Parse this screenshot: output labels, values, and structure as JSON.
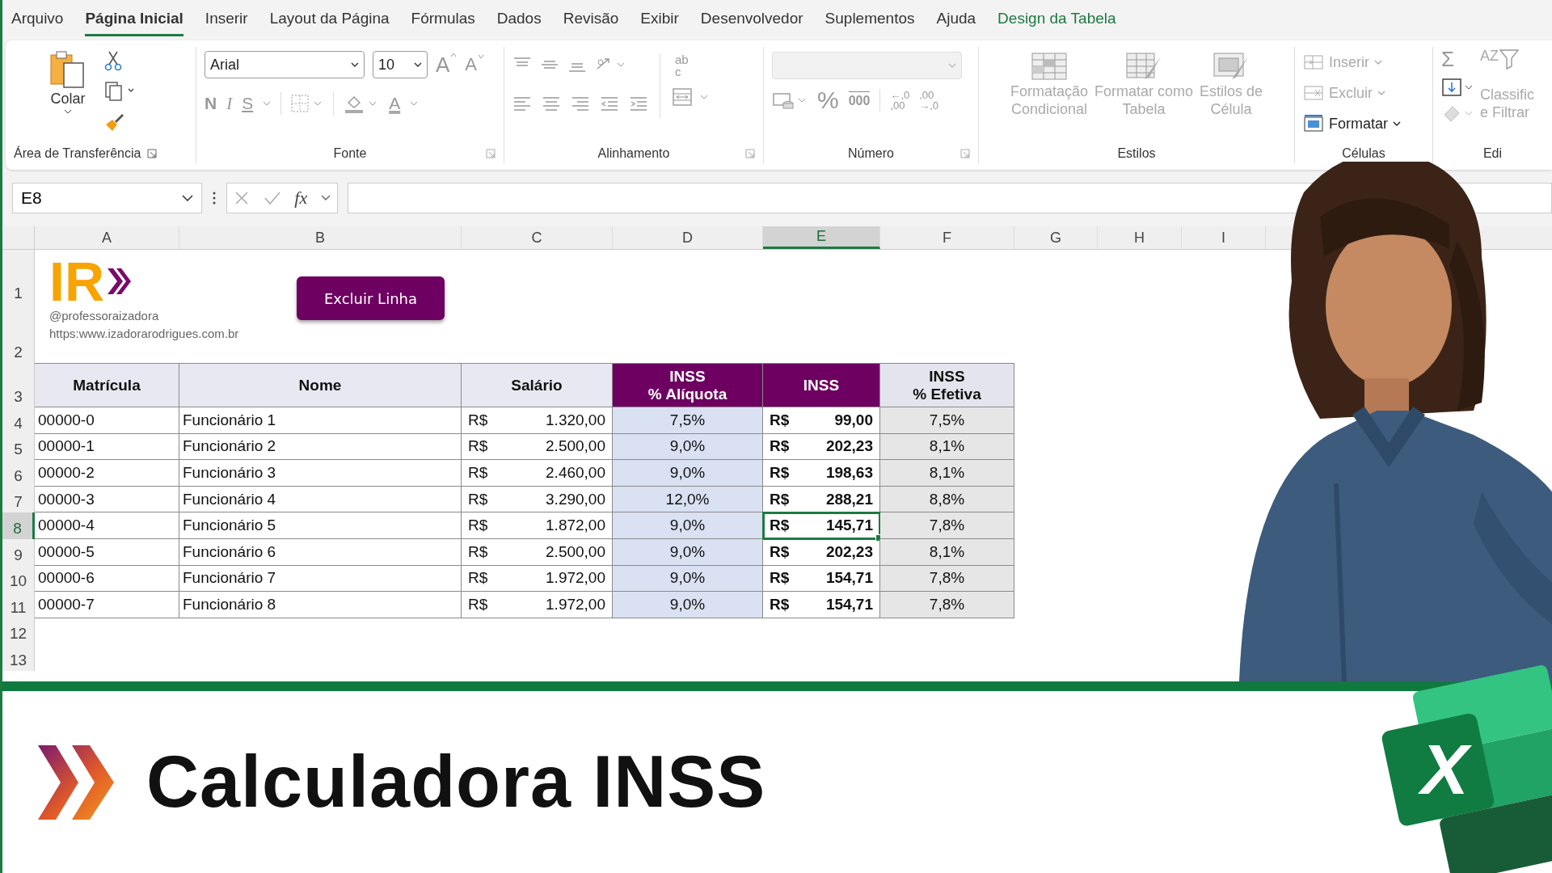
{
  "menu_tabs": [
    {
      "label": "Arquivo",
      "selected": false,
      "kind": "tab"
    },
    {
      "label": "Página Inicial",
      "selected": true,
      "kind": "tab"
    },
    {
      "label": "Inserir",
      "selected": false,
      "kind": "tab"
    },
    {
      "label": "Layout da Página",
      "selected": false,
      "kind": "tab"
    },
    {
      "label": "Fórmulas",
      "selected": false,
      "kind": "tab"
    },
    {
      "label": "Dados",
      "selected": false,
      "kind": "tab"
    },
    {
      "label": "Revisão",
      "selected": false,
      "kind": "tab"
    },
    {
      "label": "Exibir",
      "selected": false,
      "kind": "tab"
    },
    {
      "label": "Desenvolvedor",
      "selected": false,
      "kind": "tab"
    },
    {
      "label": "Suplementos",
      "selected": false,
      "kind": "tab"
    },
    {
      "label": "Ajuda",
      "selected": false,
      "kind": "tab"
    },
    {
      "label": "Design da Tabela",
      "selected": false,
      "kind": "contextual"
    }
  ],
  "ribbon": {
    "clipboard": {
      "paste": "Colar",
      "label": "Área de Transferência"
    },
    "font": {
      "family": "Arial",
      "size": "10",
      "grow": "A",
      "shrink": "A",
      "bold": "N",
      "italic": "I",
      "underline": "S",
      "color_letter": "A",
      "label": "Fonte"
    },
    "alignment": {
      "wrap_top": "ab",
      "wrap_bottom": "c",
      "label": "Alinhamento"
    },
    "number": {
      "format_disabled": true,
      "percent": "%",
      "thousands": "000",
      "inc_decimal": [
        "←,0",
        ",00"
      ],
      "dec_decimal": [
        ",00",
        "→,0"
      ],
      "label": "Número"
    },
    "styles": {
      "buttons": [
        {
          "lines": [
            "Formatação",
            "Condicional"
          ],
          "disabled": true,
          "kind": "conditional"
        },
        {
          "lines": [
            "Formatar como",
            "Tabela"
          ],
          "disabled": true,
          "kind": "table"
        },
        {
          "lines": [
            "Estilos de",
            "Célula"
          ],
          "disabled": true,
          "kind": "cell"
        }
      ],
      "label": "Estilos"
    },
    "cells": {
      "buttons": [
        {
          "label": "Inserir",
          "disabled": true,
          "kind": "insert"
        },
        {
          "label": "Excluir",
          "disabled": true,
          "kind": "delete"
        },
        {
          "label": "Formatar",
          "disabled": false,
          "kind": "format"
        }
      ],
      "label": "Células"
    },
    "editing": {
      "sum": "Σ",
      "sort_letters": [
        "A",
        "Z"
      ],
      "sort_lines": [
        "Classific",
        "e Filtrar"
      ],
      "label": "Edi"
    }
  },
  "formula_bar": {
    "name_box": "E8",
    "fx": "fx"
  },
  "sheet": {
    "columns": [
      {
        "label": "A",
        "selected": false
      },
      {
        "label": "B",
        "selected": false
      },
      {
        "label": "C",
        "selected": false
      },
      {
        "label": "D",
        "selected": false
      },
      {
        "label": "E",
        "selected": true
      },
      {
        "label": "F",
        "selected": false
      },
      {
        "label": "G",
        "selected": false
      },
      {
        "label": "H",
        "selected": false
      },
      {
        "label": "I",
        "selected": false
      }
    ],
    "rows": [
      {
        "label": "1",
        "selected": false
      },
      {
        "label": "2",
        "selected": false
      },
      {
        "label": "3",
        "selected": false
      },
      {
        "label": "4",
        "selected": false
      },
      {
        "label": "5",
        "selected": false
      },
      {
        "label": "6",
        "selected": false
      },
      {
        "label": "7",
        "selected": false
      },
      {
        "label": "8",
        "selected": true
      },
      {
        "label": "9",
        "selected": false
      },
      {
        "label": "10",
        "selected": false
      },
      {
        "label": "11",
        "selected": false
      },
      {
        "label": "12",
        "selected": false
      },
      {
        "label": "13",
        "selected": false
      }
    ]
  },
  "header_block": {
    "logo": "IR",
    "handle": "@professoraizadora",
    "url": "https:www.izadorarodrigues.com.br",
    "button": "Excluir Linha"
  },
  "table": {
    "columns": [
      {
        "lines": [
          "Matrícula"
        ],
        "kind": "plain"
      },
      {
        "lines": [
          "Nome"
        ],
        "kind": "plain"
      },
      {
        "lines": [
          "Salário"
        ],
        "kind": "plain"
      },
      {
        "lines": [
          "INSS",
          "% Alíquota"
        ],
        "kind": "accent"
      },
      {
        "lines": [
          "INSS"
        ],
        "kind": "accent"
      },
      {
        "lines": [
          "INSS",
          "% Efetiva"
        ],
        "kind": "soft"
      }
    ],
    "rows": [
      {
        "id": "00000-0",
        "name": "Funcionário 1",
        "salary_currency": "R$",
        "salary": "1.320,00",
        "rate": "7,5%",
        "inss_currency": "R$",
        "inss": "99,00",
        "effective": "7,5%",
        "selected": false
      },
      {
        "id": "00000-1",
        "name": "Funcionário 2",
        "salary_currency": "R$",
        "salary": "2.500,00",
        "rate": "9,0%",
        "inss_currency": "R$",
        "inss": "202,23",
        "effective": "8,1%",
        "selected": false
      },
      {
        "id": "00000-2",
        "name": "Funcionário 3",
        "salary_currency": "R$",
        "salary": "2.460,00",
        "rate": "9,0%",
        "inss_currency": "R$",
        "inss": "198,63",
        "effective": "8,1%",
        "selected": false
      },
      {
        "id": "00000-3",
        "name": "Funcionário 4",
        "salary_currency": "R$",
        "salary": "3.290,00",
        "rate": "12,0%",
        "inss_currency": "R$",
        "inss": "288,21",
        "effective": "8,8%",
        "selected": false
      },
      {
        "id": "00000-4",
        "name": "Funcionário 5",
        "salary_currency": "R$",
        "salary": "1.872,00",
        "rate": "9,0%",
        "inss_currency": "R$",
        "inss": "145,71",
        "effective": "7,8%",
        "selected": true
      },
      {
        "id": "00000-5",
        "name": "Funcionário 6",
        "salary_currency": "R$",
        "salary": "2.500,00",
        "rate": "9,0%",
        "inss_currency": "R$",
        "inss": "202,23",
        "effective": "8,1%",
        "selected": false
      },
      {
        "id": "00000-6",
        "name": "Funcionário 7",
        "salary_currency": "R$",
        "salary": "1.972,00",
        "rate": "9,0%",
        "inss_currency": "R$",
        "inss": "154,71",
        "effective": "7,8%",
        "selected": false
      },
      {
        "id": "00000-7",
        "name": "Funcionário 8",
        "salary_currency": "R$",
        "salary": "1.972,00",
        "rate": "9,0%",
        "inss_currency": "R$",
        "inss": "154,71",
        "effective": "7,8%",
        "selected": false
      }
    ]
  },
  "banner": {
    "title": "Calculadora INSS",
    "logo_letter": "X"
  }
}
